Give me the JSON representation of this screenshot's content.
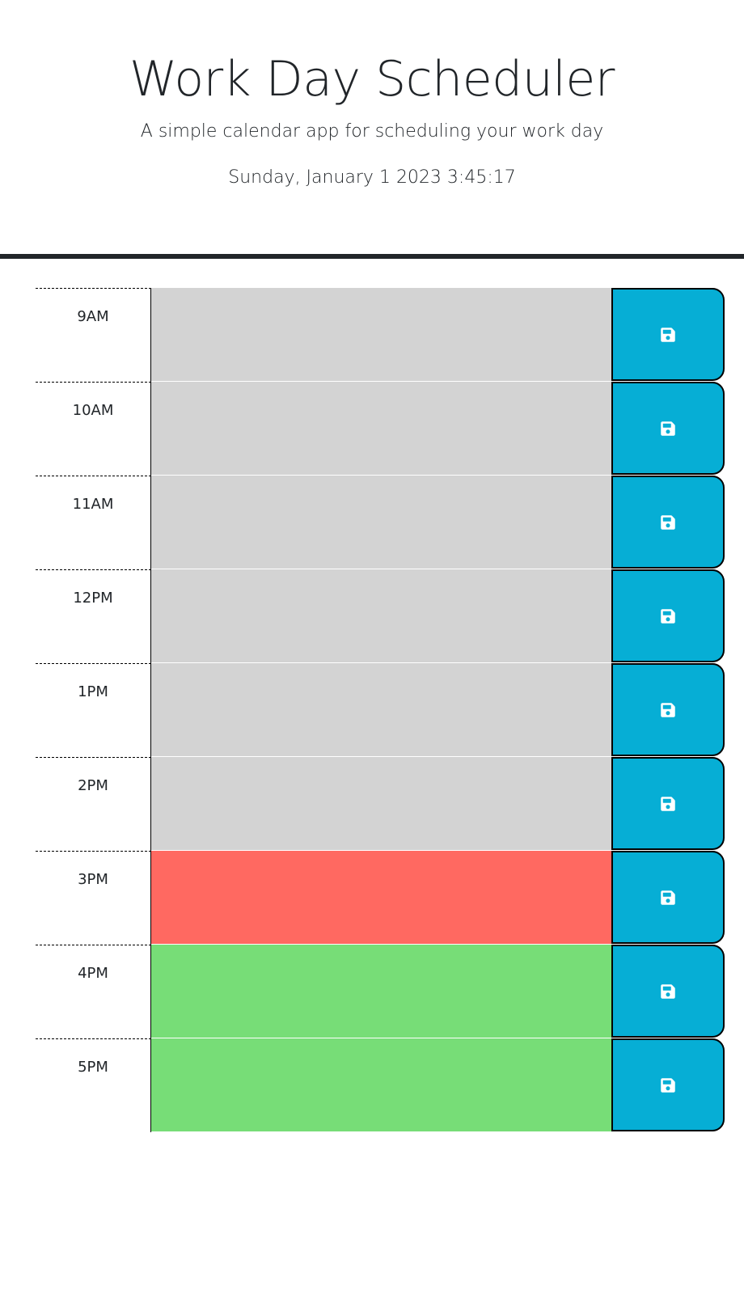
{
  "header": {
    "title": "Work Day Scheduler",
    "subtitle": "A simple calendar app for scheduling your work day",
    "current_day": "Sunday, January 1 2023 3:45:17"
  },
  "colors": {
    "past": "#d3d3d3",
    "present": "#ff6961",
    "future": "#77dd77",
    "save_button": "#06aed5",
    "save_icon": "#ffffff"
  },
  "time_blocks": [
    {
      "hour": "9AM",
      "status": "past",
      "text": ""
    },
    {
      "hour": "10AM",
      "status": "past",
      "text": ""
    },
    {
      "hour": "11AM",
      "status": "past",
      "text": ""
    },
    {
      "hour": "12PM",
      "status": "past",
      "text": ""
    },
    {
      "hour": "1PM",
      "status": "past",
      "text": ""
    },
    {
      "hour": "2PM",
      "status": "past",
      "text": ""
    },
    {
      "hour": "3PM",
      "status": "present",
      "text": ""
    },
    {
      "hour": "4PM",
      "status": "future",
      "text": ""
    },
    {
      "hour": "5PM",
      "status": "future",
      "text": ""
    }
  ],
  "icons": {
    "save": "floppy-disk-icon"
  }
}
